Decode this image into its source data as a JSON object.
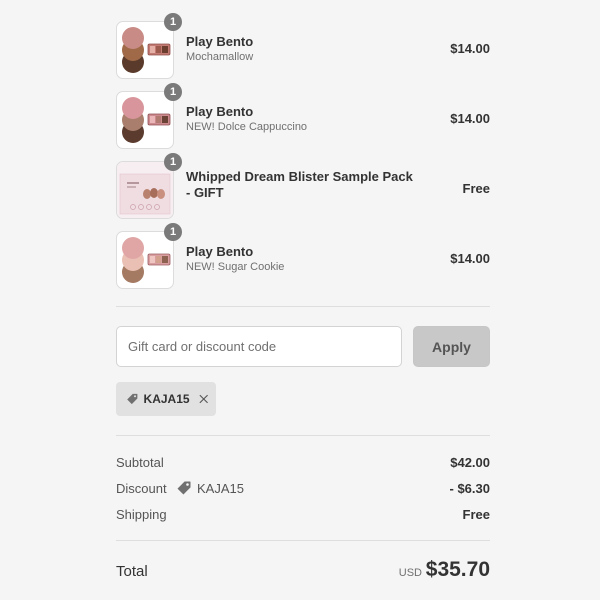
{
  "items": [
    {
      "quantity": "1",
      "name": "Play Bento",
      "variant": "Mochamallow",
      "price": "$14.00",
      "swatches": [
        "#c98b86",
        "#a06a48",
        "#5a3a2a"
      ]
    },
    {
      "quantity": "1",
      "name": "Play Bento",
      "variant": "NEW! Dolce Cappuccino",
      "price": "$14.00",
      "swatches": [
        "#d8969c",
        "#a97e6c",
        "#5b3b2e"
      ]
    },
    {
      "quantity": "1",
      "name": "Whipped Dream Blister Sample Pack - GIFT",
      "variant": "",
      "price": "Free",
      "swatches": []
    },
    {
      "quantity": "1",
      "name": "Play Bento",
      "variant": "NEW! Sugar Cookie",
      "price": "$14.00",
      "swatches": [
        "#e0a6a6",
        "#eac0b4",
        "#a47a62"
      ]
    }
  ],
  "discount_input": {
    "placeholder": "Gift card or discount code",
    "value": ""
  },
  "apply_button": "Apply",
  "applied_code": "KAJA15",
  "summary": {
    "subtotal_label": "Subtotal",
    "subtotal_value": "$42.00",
    "discount_label": "Discount",
    "discount_code": "KAJA15",
    "discount_value": "- $6.30",
    "shipping_label": "Shipping",
    "shipping_value": "Free"
  },
  "total": {
    "label": "Total",
    "currency": "USD",
    "value": "$35.70"
  }
}
